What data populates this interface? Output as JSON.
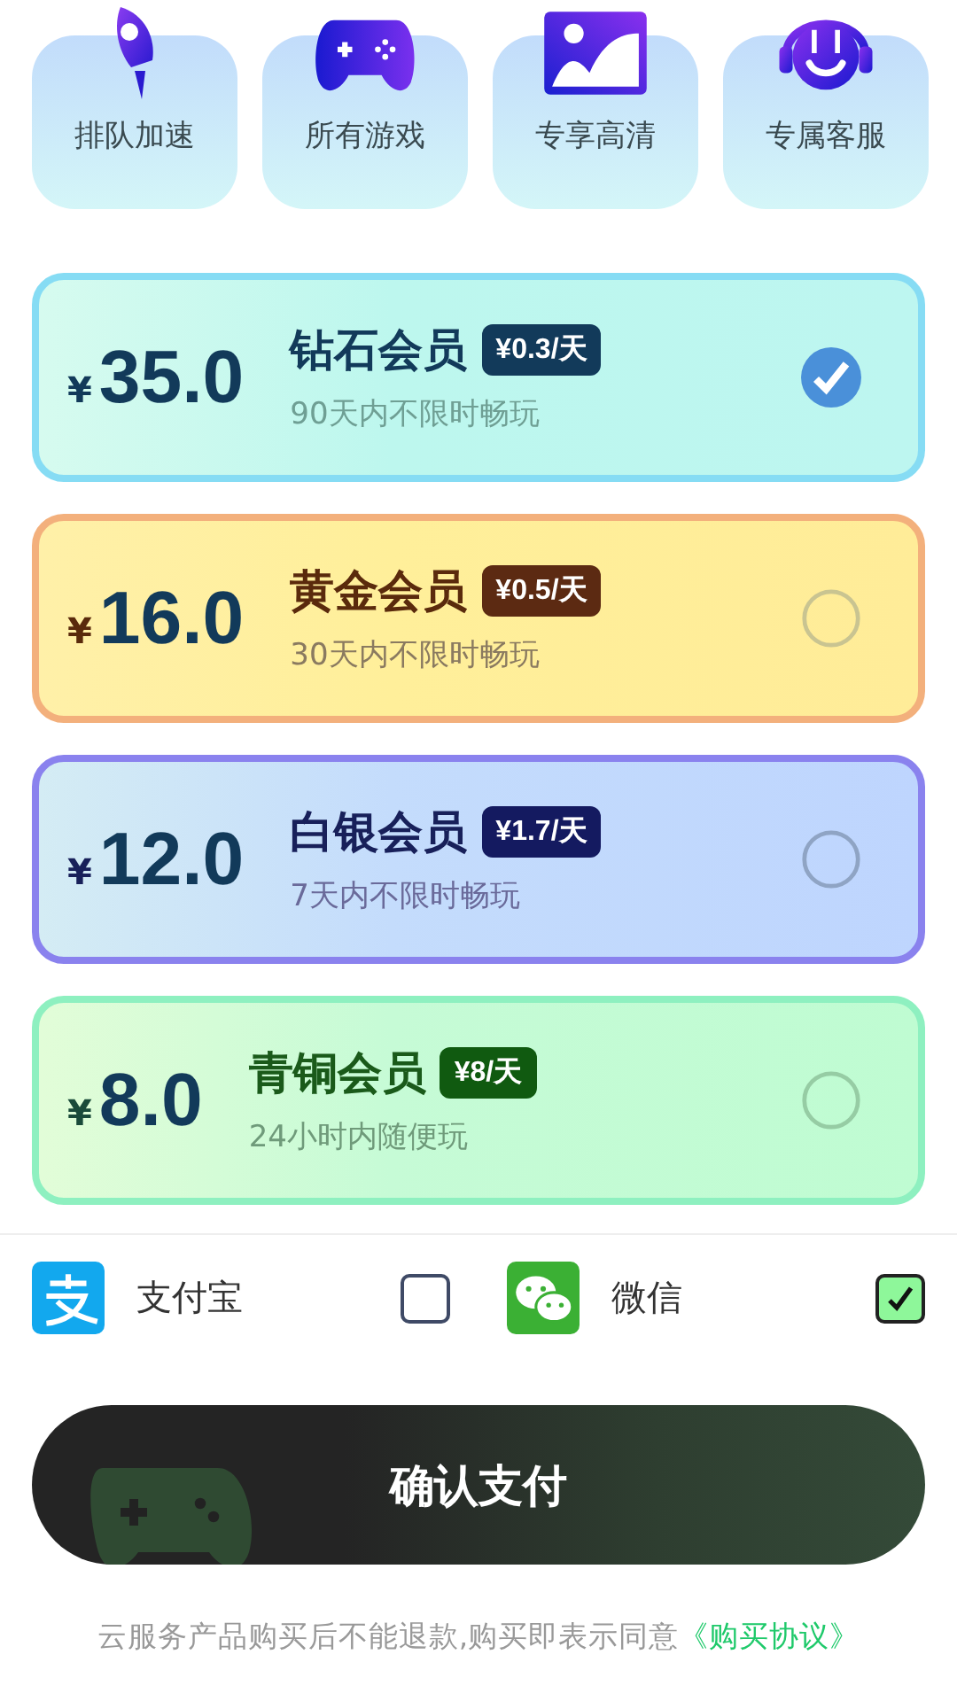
{
  "features": [
    {
      "kind": "rocket",
      "label": "排队加速"
    },
    {
      "kind": "gamepad",
      "label": "所有游戏"
    },
    {
      "kind": "image",
      "label": "专享高清"
    },
    {
      "kind": "headset",
      "label": "专属客服"
    }
  ],
  "plans": [
    {
      "kind": "diamond",
      "currency": "¥",
      "price": "35.0",
      "name": "钻石会员",
      "rate": "¥0.3/天",
      "desc": "90天内不限时畅玩",
      "selected": true
    },
    {
      "kind": "gold",
      "currency": "¥",
      "price": "16.0",
      "name": "黄金会员",
      "rate": "¥0.5/天",
      "desc": "30天内不限时畅玩",
      "selected": false
    },
    {
      "kind": "silver",
      "currency": "¥",
      "price": "12.0",
      "name": "白银会员",
      "rate": "¥1.7/天",
      "desc": "7天内不限时畅玩",
      "selected": false
    },
    {
      "kind": "bronze",
      "currency": "¥",
      "price": "8.0",
      "name": "青铜会员",
      "rate": "¥8/天",
      "desc": "24小时内随便玩",
      "selected": false
    }
  ],
  "payment_methods": [
    {
      "kind": "alipay",
      "label": "支付宝",
      "checked": false
    },
    {
      "kind": "wechat",
      "label": "微信",
      "checked": true
    }
  ],
  "confirm_button": "确认支付",
  "footer": {
    "text": "云服务产品购买后不能退款,购买即表示同意",
    "link": "《购买协议》"
  }
}
